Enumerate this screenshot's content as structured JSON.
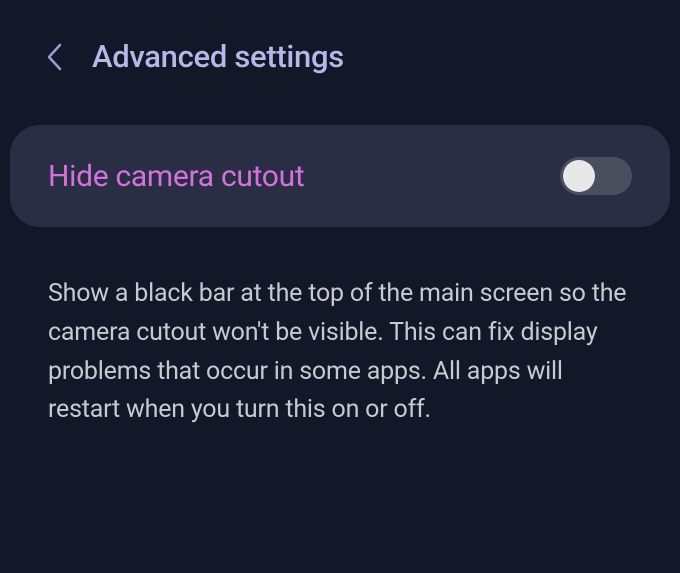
{
  "header": {
    "title": "Advanced settings"
  },
  "setting": {
    "label": "Hide camera cutout",
    "enabled": false
  },
  "description": "Show a black bar at the top of the main screen so the camera cutout won't be visible. This can fix display problems that occur in some apps. All apps will restart when you turn this on or off."
}
